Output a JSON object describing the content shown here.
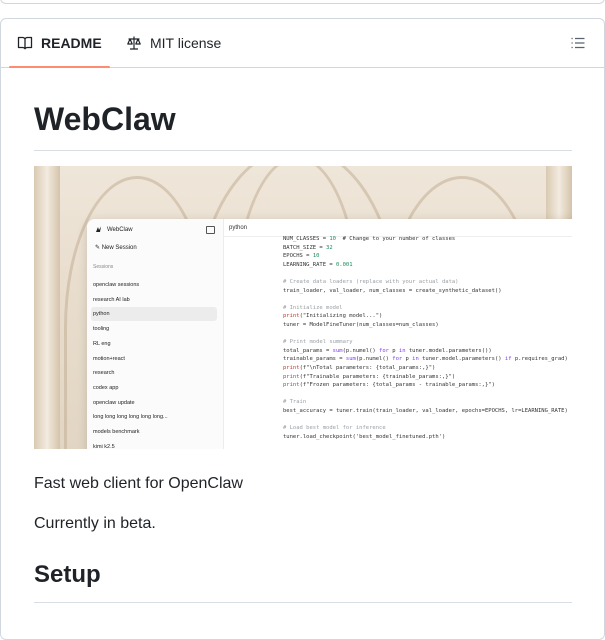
{
  "tabs": {
    "readme": "README",
    "license": "MIT license"
  },
  "readme": {
    "title": "WebClaw",
    "paragraphs": [
      "Fast web client for OpenClaw",
      "Currently in beta."
    ],
    "setup_heading": "Setup"
  },
  "screenshot": {
    "brand": "WebClaw",
    "new_session": "New Session",
    "sessions_heading": "Sessions",
    "sessions": [
      "openclaw sessions",
      "research AI lab",
      "python",
      "tooling",
      "RL eng",
      "motion+react",
      "research",
      "codex app",
      "openclaw update",
      "long long long long long long...",
      "models benchmark",
      "kimi k2.5"
    ],
    "selected_session": "python",
    "active_tab": "python",
    "code_lines": [
      "NUM_CLASSES = 10  # Change to your number of classes",
      "BATCH_SIZE = 32",
      "EPOCHS = 10",
      "LEARNING_RATE = 0.001",
      "",
      "# Create data loaders (replace with your actual data)",
      "train_loader, val_loader, num_classes = create_synthetic_dataset()",
      "",
      "# Initialize model",
      "print(\"Initializing model...\")",
      "tuner = ModelFineTuner(num_classes=num_classes)",
      "",
      "# Print model summary",
      "total_params = sum(p.numel() for p in tuner.model.parameters())",
      "trainable_params = sum(p.numel() for p in tuner.model.parameters() if p.requires_grad)",
      "print(f\"\\nTotal parameters: {total_params:,}\")",
      "print(f\"Trainable parameters: {trainable_params:,}\")",
      "print(f\"Frozen parameters: {total_params - trainable_params:,}\")",
      "",
      "# Train",
      "best_accuracy = tuner.train(train_loader, val_loader, epochs=EPOCHS, lr=LEARNING_RATE)",
      "",
      "# Load best model for inference",
      "tuner.load_checkpoint('best_model_finetuned.pth')"
    ]
  },
  "colors": {
    "tab_underline": "#fd8c73",
    "border": "#d0d7de",
    "text": "#1f2328"
  },
  "icons": {
    "readme": "book-icon",
    "license": "scale-icon",
    "outline": "list-icon"
  }
}
